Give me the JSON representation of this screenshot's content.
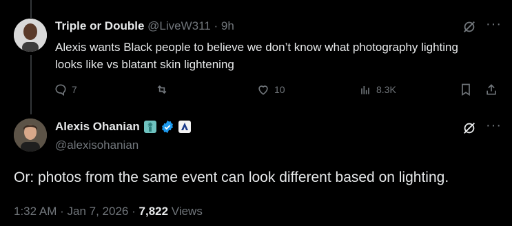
{
  "reply_tweet": {
    "author_name": "Triple or Double",
    "handle": "@LiveW311",
    "separator": "·",
    "time": "9h",
    "text": "Alexis wants Black people to believe we don’t know what photography lighting looks like vs blatant skin lightening",
    "actions": {
      "replies": "7",
      "retweets": "",
      "likes": "10",
      "views": "8.3K"
    }
  },
  "main_tweet": {
    "author_name": "Alexis Ohanian",
    "handle": "@alexisohanian",
    "text": "Or: photos from the same event can look different based on lighting.",
    "time": "1:32 AM",
    "separator": "·",
    "date": "Jan 7, 2026",
    "separator2": "·",
    "view_count": "7,822",
    "views_label": "Views"
  },
  "icons": {
    "reply": "speech-bubble-icon",
    "retweet": "retweet-icon",
    "like": "heart-icon",
    "views": "bar-chart-icon",
    "bookmark": "bookmark-icon",
    "share": "share-upload-icon",
    "grok": "grok-slash-icon",
    "more": "more-dots-icon",
    "verified": "verified-badge-icon"
  },
  "colors": {
    "background": "#000000",
    "text": "#e7e9ea",
    "muted": "#71767b",
    "verified": "#1d9bf0"
  }
}
